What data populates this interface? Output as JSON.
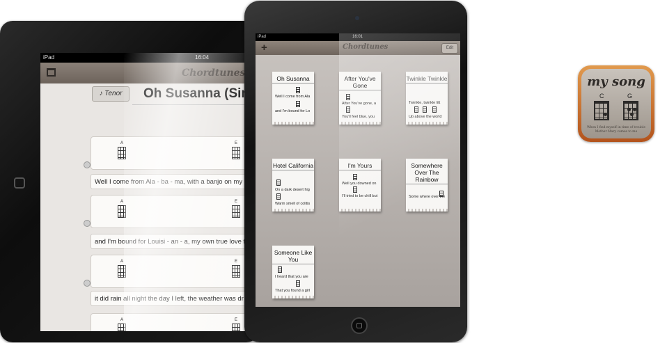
{
  "left_ipad": {
    "status": {
      "carrier": "iPad",
      "time": "16:04"
    },
    "app_title": "Chordtunes",
    "instrument_button": "Tenor",
    "song_title": "Oh Susanna (Simpl",
    "rows": [
      {
        "chord_left": "A",
        "chord_right": "E",
        "lyric": "Well I come from Ala - ba - ma, with a banjo on my kne"
      },
      {
        "chord_left": "A",
        "chord_right": "E",
        "lyric": "and I'm bound for Louisi - an - a,  my own true love for"
      },
      {
        "chord_left": "A",
        "chord_right": "E",
        "lyric": "it did rain all night the day I left,  the weather was dr"
      },
      {
        "chord_left": "A",
        "chord_right": "E",
        "lyric": ""
      }
    ]
  },
  "right_ipad": {
    "status": {
      "carrier": "iPad",
      "time": "16:01"
    },
    "app_title": "Chordtunes",
    "add_button": "+",
    "edit_button": "Edit",
    "songs": [
      {
        "title": "Oh Susanna",
        "line1": "Well I come from Ala",
        "line2": "and I'm bound for Lo"
      },
      {
        "title": "After You've Gone",
        "line1": "After You've gone, a",
        "line2": "You'll feel blue, you"
      },
      {
        "title": "Twinkle Twinkle",
        "line1": "Twinkle, twinkle litt",
        "line2": "Up above the world"
      },
      {
        "title": "Hotel California",
        "line1": "On a dark desert hig",
        "line2": "Warm smell of colitis"
      },
      {
        "title": "I'm Yours",
        "line1": "Well you downed on",
        "line2": "I'll tried to be chill but"
      },
      {
        "title": "Somewhere Over The Rainbow",
        "line1": "Some where over the",
        "line2": ""
      },
      {
        "title": "Someone Like You",
        "line1": "I heard that you are",
        "line2": "That you found a girl"
      }
    ]
  },
  "app_icon": {
    "name": "my song",
    "chord1": "C",
    "chord2": "G",
    "lyric": "When I find myself in time of trouble Mother Mary comes to me"
  }
}
